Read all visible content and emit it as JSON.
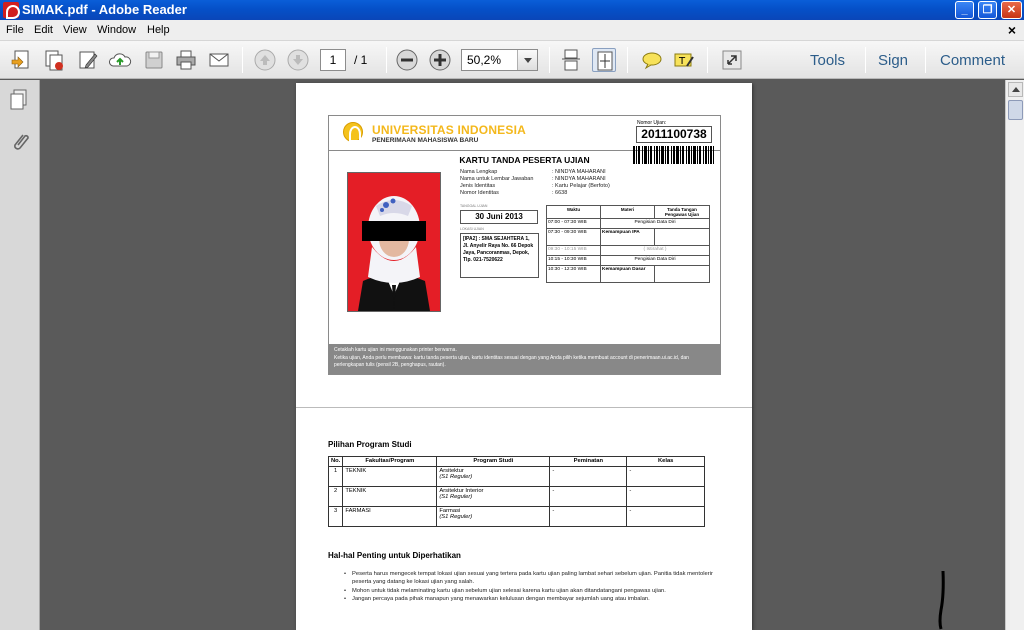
{
  "window": {
    "title": "SIMAK.pdf - Adobe Reader",
    "min": "_",
    "max": "❐",
    "close": "✕"
  },
  "menu": [
    "File",
    "Edit",
    "View",
    "Window",
    "Help"
  ],
  "menu_close": "×",
  "toolbar": {
    "page_current": "1",
    "page_total": "/ 1",
    "zoom": "50,2%",
    "tools": "Tools",
    "sign": "Sign",
    "comment": "Comment"
  },
  "card": {
    "university": "UNIVERSITAS INDONESIA",
    "subtitle": "PENERIMAAN MAHASISWA BARU",
    "exam_number_label": "Nomor Ujian:",
    "exam_number": "2011100738",
    "title": "KARTU TANDA PESERTA UJIAN",
    "info": [
      {
        "k": "Nama Lengkap",
        "v": ":  NINDYA MAHARANI"
      },
      {
        "k": "Nama untuk Lembar Jawaban",
        "v": ":  NINDYA MAHARANI"
      },
      {
        "k": "Jenis Identitas",
        "v": ":  Kartu Pelajar (Berfoto)"
      },
      {
        "k": "Nomor Identitas",
        "v": ":  6638"
      }
    ],
    "date_label": "TANGGAL UJIAN",
    "date": "30 Juni 2013",
    "location_label": "LOKASI UJIAN",
    "location": "[IPA2] : SMA SEJAHTERA 1, Jl. Anyelir Raya No. 66 Depok Jaya, Pancoranmas, Depok, Tlp. 021-7520622",
    "schedule_headers": [
      "Waktu",
      "Materi",
      "Tanda Tangan Pengawas Ujian"
    ],
    "schedule": [
      {
        "time": "07:00 - 07:30 WIB",
        "subject": "Pengisian Data Diri",
        "span": true
      },
      {
        "time": "07:30 - 09:30 WIB",
        "subject": "Kemampuan IPA",
        "span": false
      },
      {
        "time": "09:30 - 10:15 WIB",
        "subject": "( Istirahat )",
        "span": true
      },
      {
        "time": "10:15 - 10:30 WIB",
        "subject": "Pengisian Data Diri",
        "span": true
      },
      {
        "time": "10:30 - 12:30 WIB",
        "subject": "Kemampuan Dasar",
        "span": false
      }
    ],
    "footer_1": "Cetaklah kartu ujian ini menggunakan printer berwarna.",
    "footer_2": "Ketika ujian, Anda perlu membawa: kartu tanda peserta ujian, kartu identitas sesuai dengan yang Anda pilih ketika membuat account di penerimaan.ui.ac.id, dan perlengkapan tulis (pensil 2B, penghapus, rautan)."
  },
  "program": {
    "heading": "Pilihan Program Studi",
    "headers": [
      "No.",
      "Fakultas/Program",
      "Program Studi",
      "Peminatan",
      "Kelas"
    ],
    "rows": [
      {
        "no": "1",
        "fak": "TEKNIK",
        "prodi": "Arsitektur",
        "jenis": "(S1 Reguler)",
        "minat": "-",
        "kelas": "-"
      },
      {
        "no": "2",
        "fak": "TEKNIK",
        "prodi": "Arsitektur Interior",
        "jenis": "(S1 Reguler)",
        "minat": "-",
        "kelas": "-"
      },
      {
        "no": "3",
        "fak": "FARMASI",
        "prodi": "Farmasi",
        "jenis": "(S1 Reguler)",
        "minat": "-",
        "kelas": "-"
      }
    ]
  },
  "notes": {
    "heading": "Hal-hal Penting untuk Diperhatikan",
    "items": [
      "Peserta harus mengecek tempat lokasi ujian sesuai yang tertera pada kartu ujian paling lambat sehari sebelum ujian. Panitia tidak mentolerir peserta yang datang ke lokasi ujian yang salah.",
      "Mohon untuk tidak melaminating kartu ujian sebelum ujian selesai karena kartu ujian akan ditandatangani pengawas ujian.",
      "Jangan percaya pada pihak manapun yang menawarkan kelulusan dengan membayar sejumlah uang atau imbalan."
    ]
  },
  "colors": {
    "accent": "#f4b81c",
    "titlebar": "#0550c8"
  }
}
